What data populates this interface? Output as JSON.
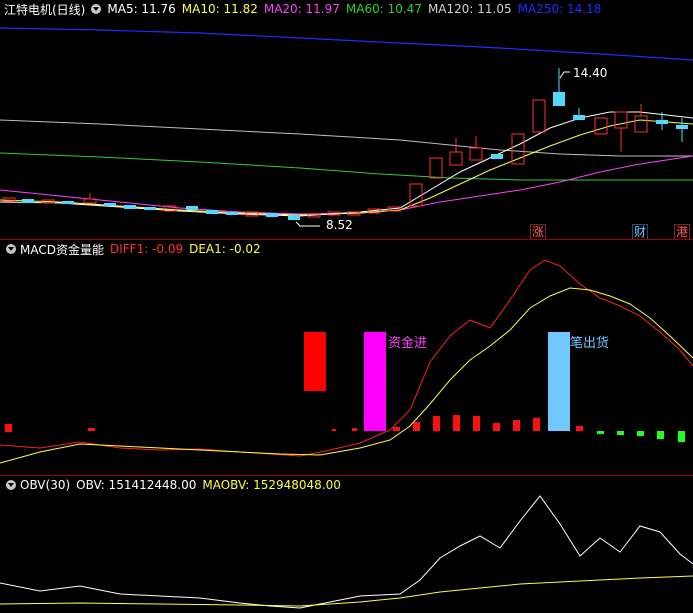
{
  "main": {
    "title": "江特电机(日线)",
    "indicators": [
      {
        "label": "MA5: 11.76",
        "color": "#ffffff"
      },
      {
        "label": "MA10: 11.82",
        "color": "#ffff40"
      },
      {
        "label": "MA20: 11.97",
        "color": "#ff40ff"
      },
      {
        "label": "MA60: 10.47",
        "color": "#30d030"
      },
      {
        "label": "MA120: 11.05",
        "color": "#d0d0d0"
      },
      {
        "label": "MA250: 14.18",
        "color": "#2828ff"
      }
    ],
    "high_label": "14.40",
    "low_label": "8.52",
    "tags": [
      {
        "text": "涨",
        "color": "#ff6060"
      },
      {
        "text": "财",
        "color": "#70c8ff"
      },
      {
        "text": "港",
        "color": "#ff6060"
      }
    ]
  },
  "macd": {
    "title": "MACD资金量能",
    "diff_label": "DIFF1: -0.09",
    "dea_label": "DEA1: -0.02",
    "annotations": {
      "in": "资金进",
      "out": "笔出货"
    }
  },
  "obv": {
    "title": "OBV(30)",
    "obv_label": "OBV: 151412448.00",
    "maobv_label": "MAOBV: 152948048.00"
  }
}
